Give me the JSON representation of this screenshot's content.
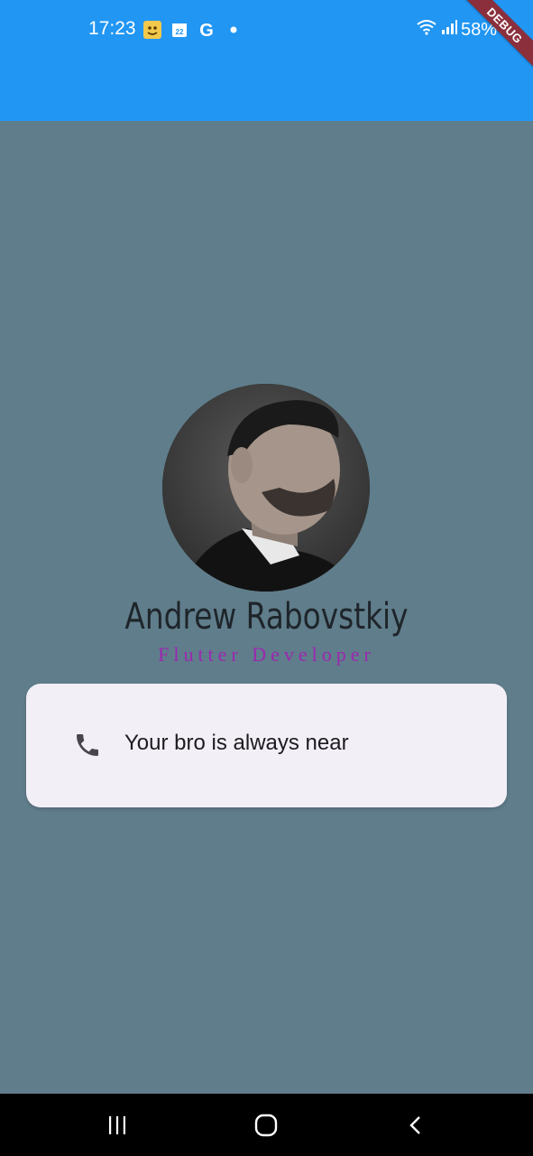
{
  "status_bar": {
    "time": "17:23",
    "battery": "58%",
    "notification_icons": [
      "emoji-sticker-icon",
      "calendar-icon",
      "google-icon",
      "dot-icon"
    ],
    "calendar_day": "22",
    "google_letter": "G"
  },
  "debug_banner": {
    "label": "DEBUG"
  },
  "profile": {
    "name": "Andrew Rabovstkiy",
    "title": "Flutter Developer",
    "avatar_icon": "profile-photo"
  },
  "contact_card": {
    "icon": "phone-icon",
    "text": "Your bro is always near"
  },
  "colors": {
    "appbar": "#2196F3",
    "background": "#607D8B",
    "card": "#F3EFF6",
    "title_accent": "#9C27B0"
  },
  "nav_bar": {
    "buttons": [
      "recent-apps-icon",
      "home-icon",
      "back-icon"
    ]
  }
}
